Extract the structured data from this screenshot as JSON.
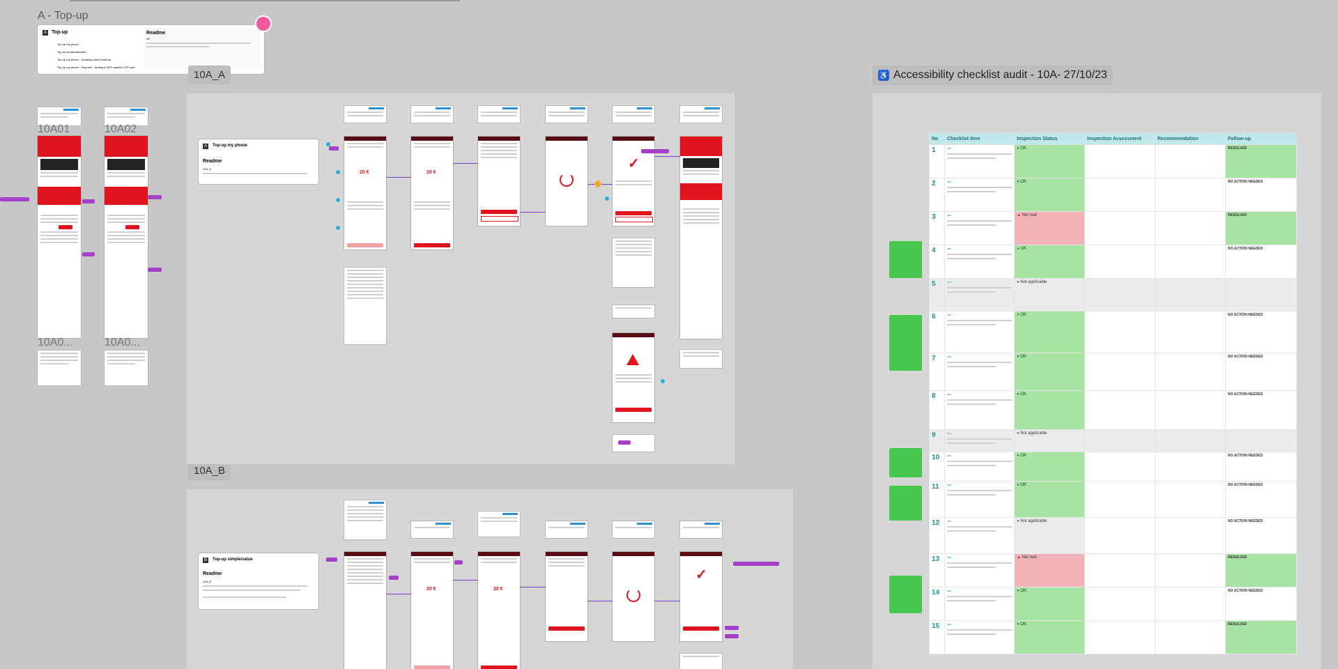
{
  "section": {
    "title": "A - Top-up"
  },
  "readme_card": {
    "badge": "A",
    "title": "Top-up",
    "items": [
      "Top-up my phone",
      "Top-up simple/standard",
      "Top-up my phone - Updating stored method",
      "Top-up my phone - Payment - Adding a 3DS-capable OTP card"
    ],
    "readme_title": "Readme",
    "readme_label": "A0"
  },
  "frames": {
    "a": {
      "label": "10A_A"
    },
    "b": {
      "label": "10A_B"
    }
  },
  "phone_labels": [
    "10A01",
    "10A02",
    "10A0...",
    "10A0..."
  ],
  "flow_a_card": {
    "badge": "A",
    "title": "Top-up my phone",
    "readme_title": "Readme",
    "readme_label": "10A_A"
  },
  "flow_b_card": {
    "badge": "B",
    "title": "Top-up simple/value",
    "readme_title": "Readme",
    "readme_label": "10A_B"
  },
  "phone_amounts": {
    "value": "20 €"
  },
  "audit": {
    "title": "Accessibility checklist audit - 10A- 27/10/23",
    "icon": "accessibility-icon",
    "columns": [
      "No",
      "Checklist Item",
      "Inspection Status",
      "Inspection Assessment",
      "Recommendation",
      "Follow-up"
    ],
    "rows": [
      {
        "no": "1",
        "status": "OK",
        "state": "ok",
        "follow": "RESOLVED"
      },
      {
        "no": "2",
        "status": "OK",
        "state": "ok",
        "follow": "NO ACTION NEEDED"
      },
      {
        "no": "3",
        "status": "Not met",
        "state": "fail",
        "follow": "RESOLVED"
      },
      {
        "no": "4",
        "status": "OK",
        "state": "ok",
        "follow": "NO ACTION NEEDED"
      },
      {
        "no": "5",
        "status": "Not applicable",
        "state": "na",
        "follow": ""
      },
      {
        "no": "6",
        "status": "OK",
        "state": "ok",
        "follow": "NO ACTION NEEDED"
      },
      {
        "no": "7",
        "status": "OK",
        "state": "ok",
        "follow": "NO ACTION NEEDED"
      },
      {
        "no": "8",
        "status": "OK",
        "state": "ok",
        "follow": "NO ACTION NEEDED"
      },
      {
        "no": "9",
        "status": "Not applicable",
        "state": "na",
        "follow": ""
      },
      {
        "no": "10",
        "status": "OK",
        "state": "ok",
        "follow": "NO ACTION NEEDED"
      },
      {
        "no": "11",
        "status": "OK",
        "state": "ok",
        "follow": "NO ACTION NEEDED"
      },
      {
        "no": "12",
        "status": "Not applicable",
        "state": "na",
        "follow": "NO ACTION NEEDED"
      },
      {
        "no": "13",
        "status": "Not met",
        "state": "fail",
        "follow": "RESOLVED"
      },
      {
        "no": "14",
        "status": "OK",
        "state": "ok",
        "follow": "NO ACTION NEEDED"
      },
      {
        "no": "15",
        "status": "OK",
        "state": "ok",
        "follow": "RESOLVED"
      }
    ]
  },
  "colors": {
    "canvas": "#c7c7c7",
    "brand_red": "#e1141e",
    "connector": "#a63fc8",
    "table_header": "#bfe8ea",
    "ok_green": "#a7e3a3",
    "fail_red": "#f1b3b7"
  }
}
